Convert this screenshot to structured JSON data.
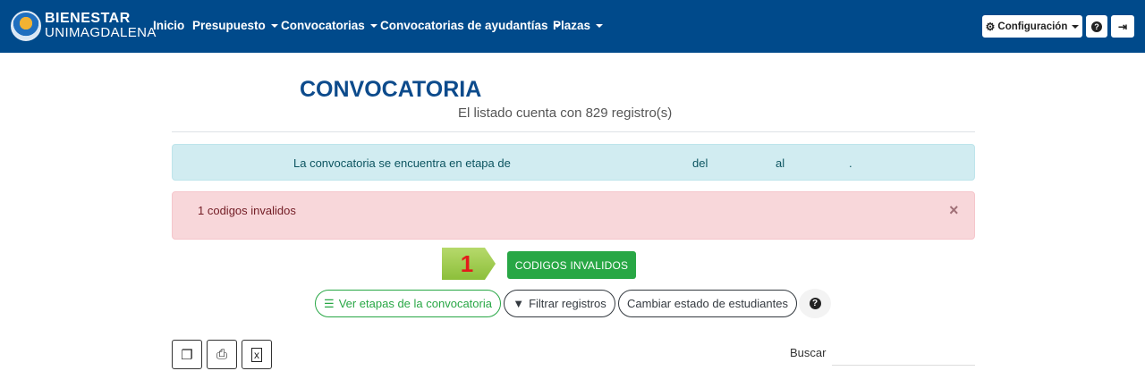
{
  "navbar": {
    "brand_line1": "BIENESTAR",
    "brand_line2": "UNIMAGDALENA",
    "items": [
      {
        "label": "Inicio"
      },
      {
        "label": "Presupuesto"
      },
      {
        "label": "Convocatorias"
      },
      {
        "label": "Convocatorias de ayudantías"
      },
      {
        "label": "Plazas"
      }
    ],
    "config_label": "Configuración",
    "help_icon": "question-circle-icon",
    "logout_icon": "sign-out-icon"
  },
  "page": {
    "title": "CONVOCATORIA",
    "subtitle": "El listado cuenta con 829 registro(s)"
  },
  "alert_info": {
    "text": "La convocatoria se encuentra en etapa de",
    "del": "del",
    "al": "al",
    "end": "."
  },
  "alert_danger": {
    "message": "1 codigos invalidos",
    "close": "×"
  },
  "step_badge": "1",
  "invalid_codes_button": "CODIGOS INVALIDOS",
  "actions": {
    "ver_etapas": "Ver etapas de la convocatoria",
    "filtrar": "Filtrar registros",
    "cambiar_estado": "Cambiar estado de estudiantes",
    "help": "?"
  },
  "tools": {
    "copy_icon": "copy-icon",
    "print_icon": "print-icon",
    "excel_icon": "excel-file-icon"
  },
  "search": {
    "label": "Buscar",
    "value": ""
  },
  "colors": {
    "navbar": "#004a8b",
    "title": "#0d4b8c",
    "success": "#28a745",
    "info_bg": "#d1ecf1",
    "danger_bg": "#f8d7da"
  }
}
